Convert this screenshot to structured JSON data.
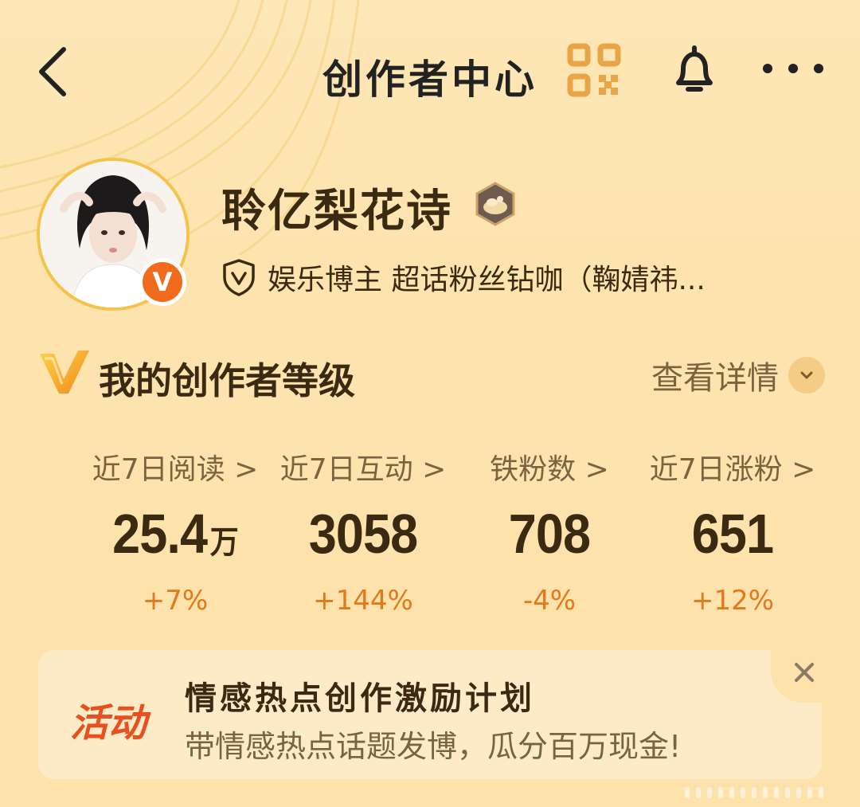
{
  "header": {
    "title": "创作者中心"
  },
  "profile": {
    "name": "聆亿梨花诗",
    "description": "娱乐博主 超话粉丝钻咖（鞠婧祎...",
    "verified_badge": "V"
  },
  "level": {
    "label": "我的创作者等级",
    "detail_link": "查看详情"
  },
  "stats": [
    {
      "label": "近7日阅读",
      "value": "25.4",
      "unit": "万",
      "change": "+7%"
    },
    {
      "label": "近7日互动",
      "value": "3058",
      "unit": "",
      "change": "+144%"
    },
    {
      "label": "铁粉数",
      "value": "708",
      "unit": "",
      "change": "-4%"
    },
    {
      "label": "近7日涨粉",
      "value": "651",
      "unit": "",
      "change": "+12%"
    }
  ],
  "activity": {
    "tag": "活动",
    "title": "情感热点创作激励计划",
    "subtitle": "带情感热点话题发博，瓜分百万现金!"
  },
  "colors": {
    "accent_orange": "#e07a1c",
    "tag_red": "#e8511f",
    "badge_orange": "#f26a1b",
    "avatar_ring": "#f5c24a"
  },
  "icons": {
    "back": "back-arrow-icon",
    "qr": "qr-code-icon",
    "bell": "bell-icon",
    "more": "more-dots-icon",
    "medal": "level-medal-icon",
    "shield": "shield-v-icon",
    "vlogo": "creator-v-logo-icon",
    "chevron": "chevron-down-icon",
    "close": "close-icon"
  }
}
